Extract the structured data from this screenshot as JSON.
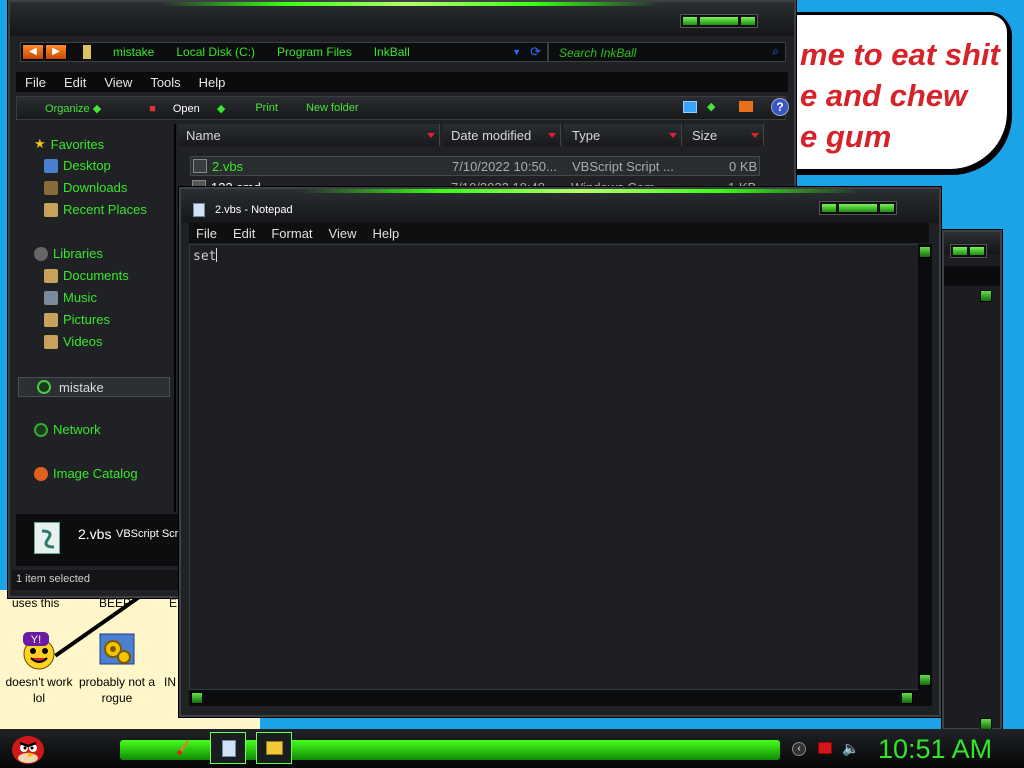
{
  "wallpaper": {
    "bubble_text": "me to eat shit\ne and chew\ne gum"
  },
  "desktop": {
    "labels_top": [
      "uses this",
      "BEEP",
      "E"
    ],
    "icons": [
      {
        "label": "doesn't work lol",
        "icon": "yahoo-messenger-icon"
      },
      {
        "label": "probably not a rogue",
        "icon": "gear-settings-icon"
      },
      {
        "label": "IN",
        "icon": "orange-app-icon"
      }
    ]
  },
  "explorer": {
    "breadcrumbs": [
      "mistake",
      "Local Disk (C:)",
      "Program Files",
      "InkBall"
    ],
    "search_placeholder": "Search InkBall",
    "menu": [
      "File",
      "Edit",
      "View",
      "Tools",
      "Help"
    ],
    "toolbar": [
      "Organize",
      "Open",
      "Print",
      "New folder"
    ],
    "nav": {
      "favorites": {
        "label": "Favorites",
        "items": [
          "Desktop",
          "Downloads",
          "Recent Places"
        ]
      },
      "libraries": {
        "label": "Libraries",
        "items": [
          "Documents",
          "Music",
          "Pictures",
          "Videos"
        ]
      },
      "selected": "mistake",
      "network": "Network",
      "image_catalog": "Image Catalog"
    },
    "columns": [
      "Name",
      "Date modified",
      "Type",
      "Size"
    ],
    "files": [
      {
        "name": "2.vbs",
        "date": "7/10/2022 10:50...",
        "type": "VBScript Script ...",
        "size": "0 KB"
      },
      {
        "name": "123.cmd",
        "date": "7/10/2022 10:48...",
        "type": "Windows Com...",
        "size": "1 KB"
      }
    ],
    "details": {
      "name": "2.vbs",
      "type": "VBScript Scr"
    },
    "status": "1 item selected"
  },
  "notepad": {
    "title": "2.vbs - Notepad",
    "menu": [
      "File",
      "Edit",
      "Format",
      "View",
      "Help"
    ],
    "content": "set"
  },
  "taskbar": {
    "clock": "10:51 AM",
    "colors": {
      "accent": "#39e62a",
      "glow": "#47ff1d"
    }
  }
}
